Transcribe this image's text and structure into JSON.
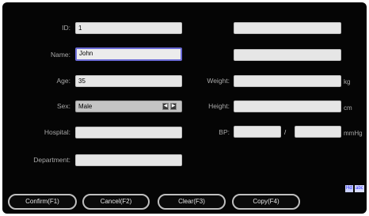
{
  "form": {
    "id": {
      "label": "ID:",
      "value": "1"
    },
    "name": {
      "label": "Name:",
      "value": "John"
    },
    "age": {
      "label": "Age:",
      "value": "35"
    },
    "sex": {
      "label": "Sex:",
      "value": "Male"
    },
    "hospital": {
      "label": "Hospital:",
      "value": ""
    },
    "department": {
      "label": "Department:",
      "value": ""
    },
    "extra1": {
      "value": ""
    },
    "extra2": {
      "value": ""
    },
    "weight": {
      "label": "Weight:",
      "value": "",
      "unit": "kg"
    },
    "height": {
      "label": "Height:",
      "value": "",
      "unit": "cm"
    },
    "bp": {
      "label": "BP:",
      "systolic": "",
      "separator": "/",
      "diastolic": "",
      "unit": "mmHg"
    }
  },
  "ime": {
    "mode1": "Hd",
    "mode2": "abc"
  },
  "buttons": {
    "confirm": "Confirm(F1)",
    "cancel": "Cancel(F2)",
    "clear": "Clear(F3)",
    "copy": "Copy(F4)"
  },
  "colors": {
    "panel": "#050505",
    "field": "#e6e6e6",
    "focus": "#6b6bd6",
    "label": "#a9a9a9"
  }
}
